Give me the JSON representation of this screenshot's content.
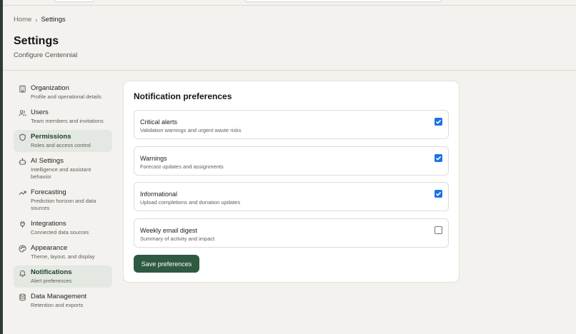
{
  "breadcrumb": {
    "home": "Home",
    "separator": "›",
    "current": "Settings"
  },
  "page": {
    "title": "Settings",
    "subtitle": "Configure Centennial"
  },
  "sidebar": {
    "items": [
      {
        "label": "Organization",
        "desc": "Profile and operational details",
        "icon": "building-icon",
        "active": false
      },
      {
        "label": "Users",
        "desc": "Team members and invitations",
        "icon": "users-icon",
        "active": false
      },
      {
        "label": "Permissions",
        "desc": "Roles and access control",
        "icon": "shield-icon",
        "active": true
      },
      {
        "label": "AI Settings",
        "desc": "Intelligence and assistant behavior",
        "icon": "bot-icon",
        "active": false
      },
      {
        "label": "Forecasting",
        "desc": "Prediction horizon and data sources",
        "icon": "trending-up-icon",
        "active": false
      },
      {
        "label": "Integrations",
        "desc": "Connected data sources",
        "icon": "plug-icon",
        "active": false
      },
      {
        "label": "Appearance",
        "desc": "Theme, layout, and display",
        "icon": "palette-icon",
        "active": false
      },
      {
        "label": "Notifications",
        "desc": "Alert preferences",
        "icon": "bell-icon",
        "active": true
      },
      {
        "label": "Data Management",
        "desc": "Retention and exports",
        "icon": "database-icon",
        "active": false
      }
    ]
  },
  "notifications": {
    "title": "Notification preferences",
    "items": [
      {
        "label": "Critical alerts",
        "desc": "Validation warnings and urgent waste risks",
        "checked": true
      },
      {
        "label": "Warnings",
        "desc": "Forecast updates and assignments",
        "checked": true
      },
      {
        "label": "Informational",
        "desc": "Upload completions and donation updates",
        "checked": true
      },
      {
        "label": "Weekly email digest",
        "desc": "Summary of activity and impact",
        "checked": false
      }
    ],
    "save_label": "Save preferences"
  },
  "colors": {
    "accent": "#2d5a41",
    "active_bg": "#e4e8e2",
    "checkbox": "#1a73e8"
  }
}
